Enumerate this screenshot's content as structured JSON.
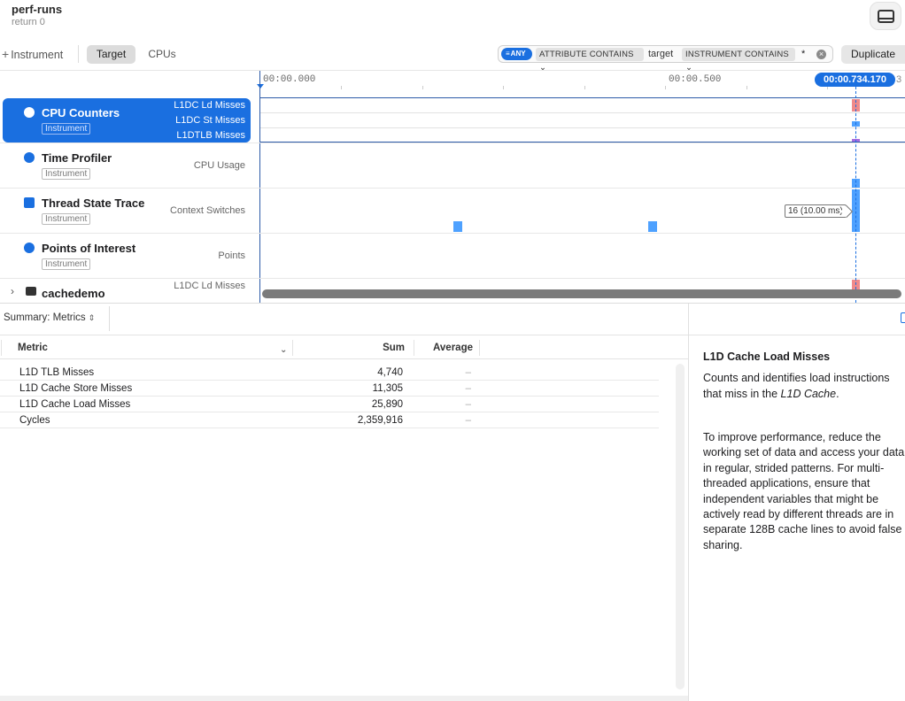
{
  "window": {
    "title": "perf-runs",
    "subtitle": "return 0"
  },
  "toolbar": {
    "add_instrument_label": "Instrument",
    "tabs": [
      {
        "label": "Target",
        "selected": true
      },
      {
        "label": "CPUs",
        "selected": false
      }
    ],
    "filter": {
      "mode_label": "ANY",
      "tokens": [
        {
          "label": "ATTRIBUTE CONTAINS",
          "value": "target"
        },
        {
          "label": "INSTRUMENT CONTAINS",
          "value": "*"
        }
      ]
    },
    "duplicate_label": "Duplicate"
  },
  "timeline": {
    "ruler_labels": [
      "00:00.000",
      "00:00.500"
    ],
    "playhead": "00:00.734.170",
    "ruler_overflow": "3",
    "lane_callout": "16 (10.00 ms)"
  },
  "instruments": [
    {
      "name": "CPU Counters",
      "tag": "Instrument",
      "metrics": [
        "L1DC Ld Misses",
        "L1DC St Misses",
        "L1DTLB Misses"
      ],
      "selected": true,
      "icon": "cpu-counter-icon"
    },
    {
      "name": "Time Profiler",
      "tag": "Instrument",
      "metrics": [
        "CPU Usage"
      ],
      "selected": false,
      "icon": "clock-icon"
    },
    {
      "name": "Thread State Trace",
      "tag": "Instrument",
      "metrics": [
        "Context Switches"
      ],
      "selected": false,
      "icon": "thread-icon"
    },
    {
      "name": "Points of Interest",
      "tag": "Instrument",
      "metrics": [
        "Points"
      ],
      "selected": false,
      "icon": "pin-icon"
    },
    {
      "name": "cachedemo",
      "tag": "",
      "metrics": [
        "L1DC Ld Misses"
      ],
      "selected": false,
      "icon": "terminal-icon"
    }
  ],
  "summary": {
    "selector_label": "Summary: Metrics"
  },
  "table": {
    "columns": [
      "Metric",
      "Sum",
      "Average"
    ],
    "rows": [
      {
        "metric": "L1D TLB Misses",
        "sum": "4,740",
        "average": "–"
      },
      {
        "metric": "L1D Cache Store Misses",
        "sum": "11,305",
        "average": "–"
      },
      {
        "metric": "L1D Cache Load Misses",
        "sum": "25,890",
        "average": "–"
      },
      {
        "metric": "Cycles",
        "sum": "2,359,916",
        "average": "–"
      }
    ]
  },
  "detail": {
    "title": "L1D Cache Load Misses",
    "p1_pre": "Counts and identifies load instructions that miss in the ",
    "p1_em": "L1D Cache",
    "p1_post": ".",
    "p2": "To improve performance, reduce the working set of data and access your data in regular, strided patterns. For multi-threaded applications, ensure that independent variables that might be actively read by different threads are in separate 128B cache lines to avoid false sharing."
  },
  "colors": {
    "accent": "#1a6fe0",
    "mark_red": "#f08a8a",
    "mark_blue": "#4ea1ff",
    "mark_purple": "#a66ce0"
  }
}
